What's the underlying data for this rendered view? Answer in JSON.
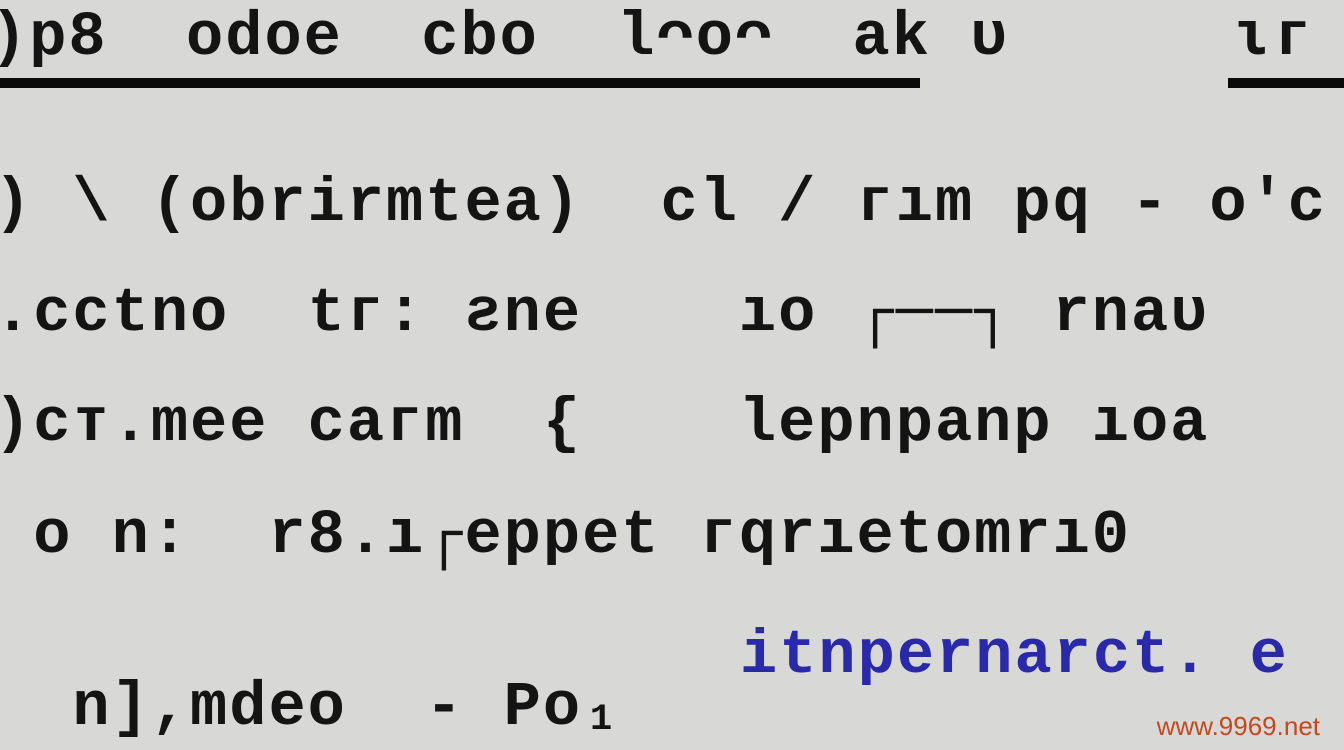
{
  "header": {
    "seg1": ")p8  odoe  cbo  lᴖoᴖ  ak ᴜ  ",
    "seg2": "ɩᴦ"
  },
  "lines": {
    "l1": ") \\ (obrirmtea)  cl / ᴦım pq - o'c",
    "l2": ".cctno  tᴦ: ƨne    ıo ┌──┐ rnaᴜ",
    "l3": ")cᴛ.mee caᴦm  {    lepnpanp ıoa",
    "l4": " o n:  r8.ı┌eppet ᴦqrıetomrı0",
    "l5a": "  n],mdeo  - Po₁",
    "l5b": "itnpernarct. e"
  },
  "watermark": "www.9969.net"
}
